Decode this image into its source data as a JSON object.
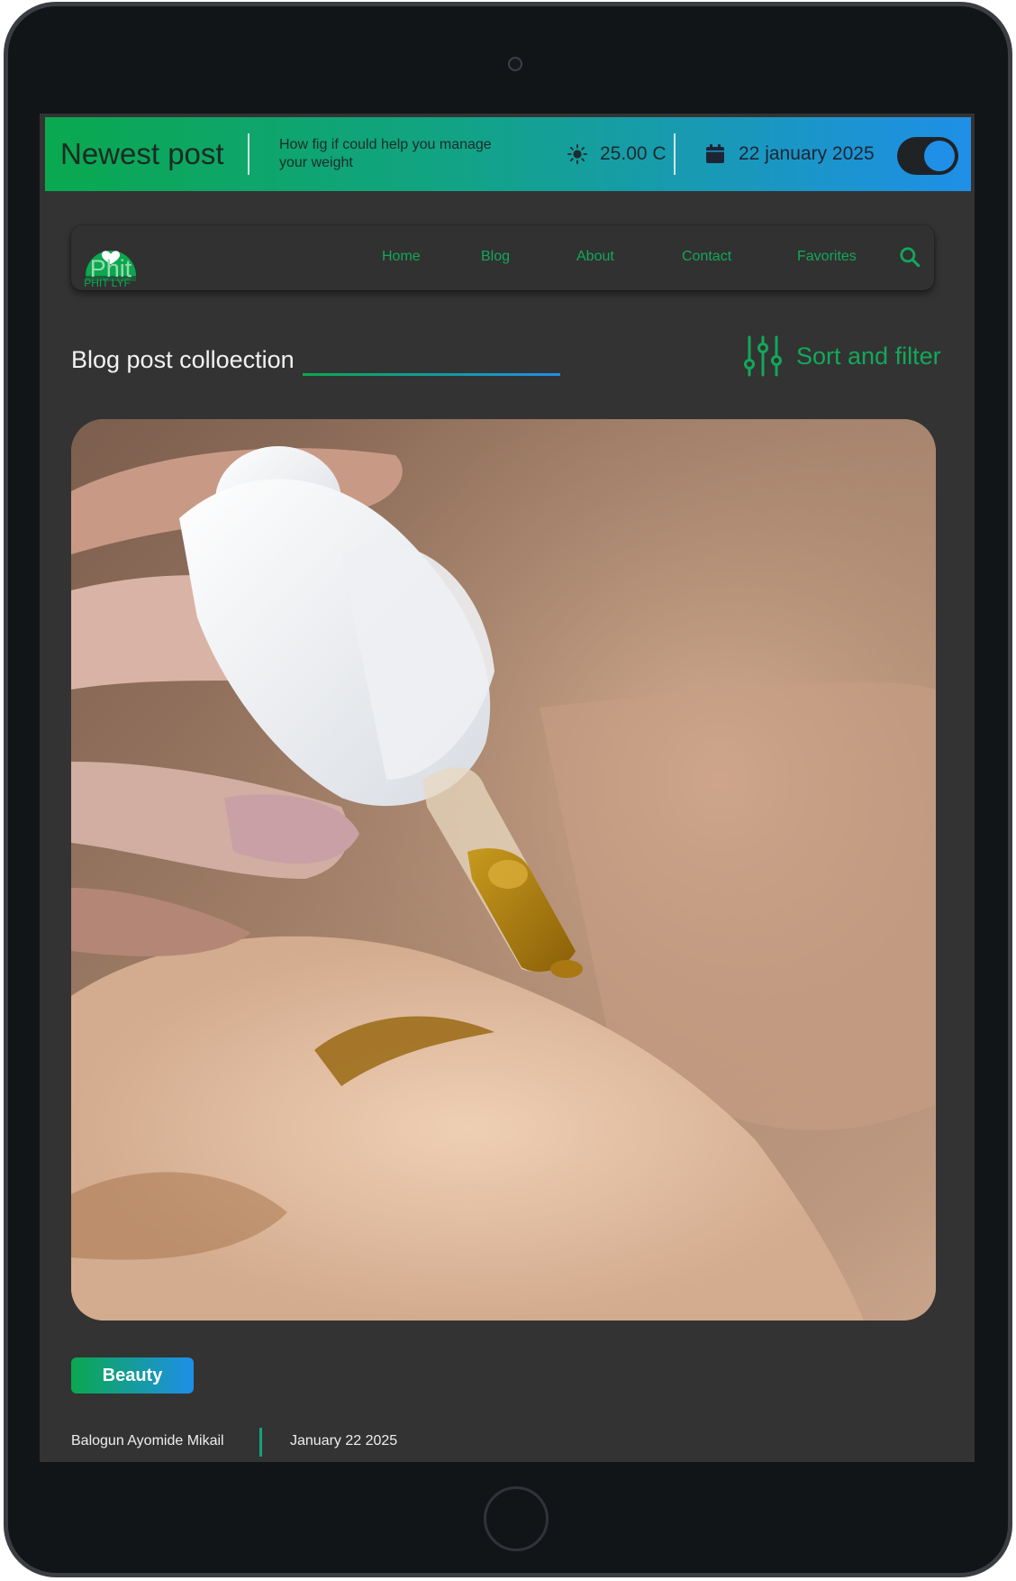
{
  "topbar": {
    "title": "Newest post",
    "subtitle": "How fig if could help you manage your weight",
    "weather_icon": "sun-icon",
    "temperature": "25.00 C",
    "calendar_icon": "calendar-icon",
    "date": "22 january 2025",
    "toggle_on": true
  },
  "logo": {
    "text": "Phit",
    "subtext": "PHIT LYF"
  },
  "nav": {
    "items": [
      {
        "label": "Home"
      },
      {
        "label": "Blog"
      },
      {
        "label": "About"
      },
      {
        "label": "Contact"
      },
      {
        "label": "Favorites"
      }
    ],
    "search_icon": "search-icon"
  },
  "section": {
    "title": "Blog post colloection",
    "sort_label": "Sort and filter",
    "sort_icon": "sliders-icon"
  },
  "post": {
    "category": "Beauty",
    "author": "Balogun Ayomide Mikail",
    "date": "January 22 2025"
  },
  "colors": {
    "accent_green": "#0aa84f",
    "accent_blue": "#1f8fe8",
    "background": "#333333"
  }
}
